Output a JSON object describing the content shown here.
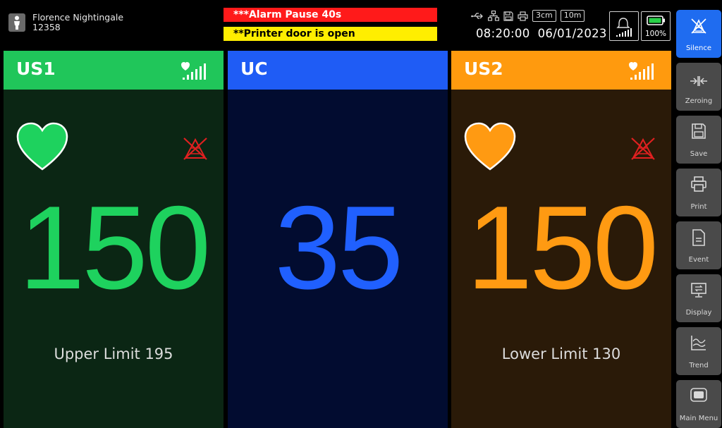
{
  "patient": {
    "name": "Florence Nightingale",
    "id": "12358",
    "icon": "patient-icon"
  },
  "alarms": {
    "primary": "***Alarm Pause 40s",
    "secondary": "**Printer door is open",
    "primary_color": "#ff1a1a",
    "secondary_color": "#ffee00"
  },
  "status": {
    "icons": [
      "usb-icon",
      "network-icon",
      "storage-icon",
      "printer-status-icon"
    ],
    "scale": "3cm",
    "duration": "10m",
    "time": "08:20:00",
    "date": "06/01/2023",
    "battery": "100%"
  },
  "panels": [
    {
      "id": "us1",
      "title": "US1",
      "value": "150",
      "limit_text": "Upper Limit 195",
      "header_color": "#20c65a",
      "body_color": "#0b2614",
      "value_color": "#1ed25e"
    },
    {
      "id": "uc",
      "title": "UC",
      "value": "35",
      "limit_text": "",
      "header_color": "#1f5cf5",
      "body_color": "#020c30",
      "value_color": "#2060ff"
    },
    {
      "id": "us2",
      "title": "US2",
      "value": "150",
      "limit_text": "Lower Limit 130",
      "header_color": "#ff9a0e",
      "body_color": "#2a1a08",
      "value_color": "#ff9a12"
    }
  ],
  "sidebar": {
    "buttons": [
      {
        "label": "Silence",
        "icon": "silence-icon",
        "active": true
      },
      {
        "label": "Zeroing",
        "icon": "zeroing-icon"
      },
      {
        "label": "Save",
        "icon": "save-icon"
      },
      {
        "label": "Print",
        "icon": "print-icon"
      },
      {
        "label": "Event",
        "icon": "event-icon"
      },
      {
        "label": "Display",
        "icon": "display-icon"
      },
      {
        "label": "Trend",
        "icon": "trend-icon"
      },
      {
        "label": "Main Menu",
        "icon": "main-menu-icon"
      }
    ]
  }
}
